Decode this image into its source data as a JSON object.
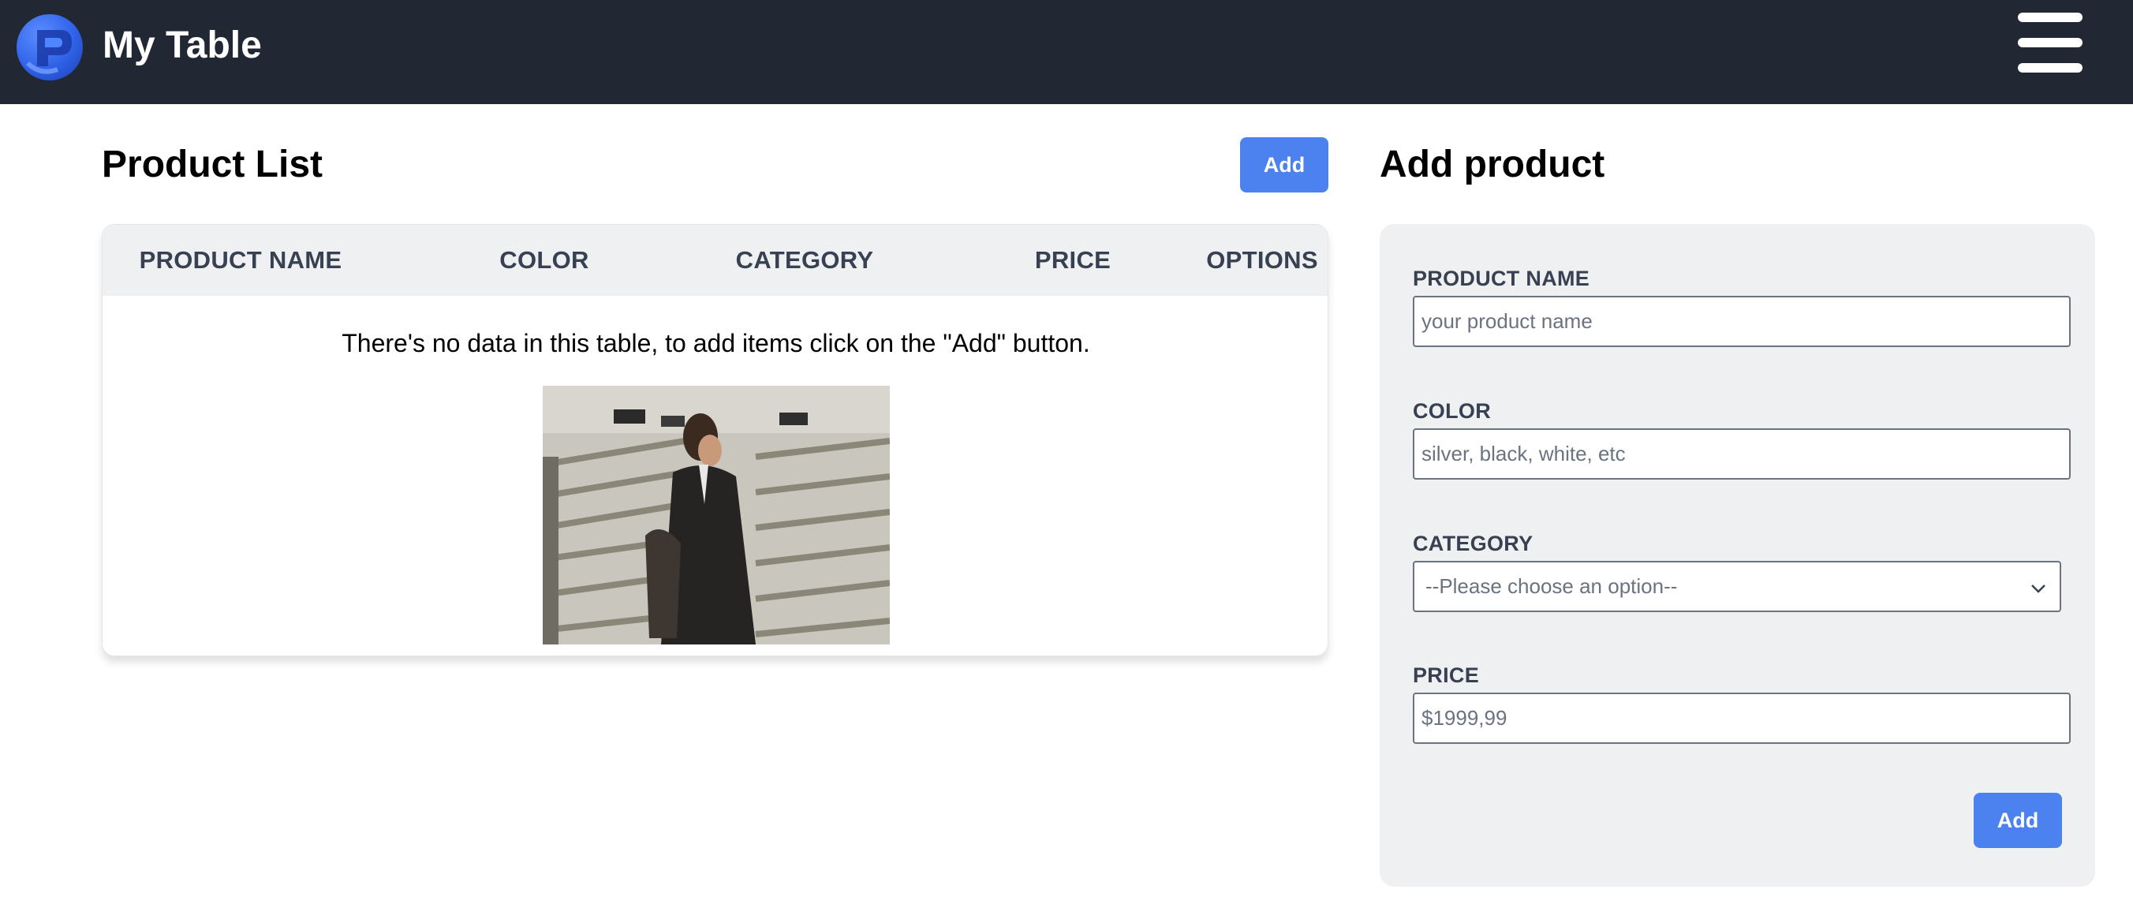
{
  "navbar": {
    "brand": "My Table",
    "logo_icon": "logo-icon",
    "menu_icon": "hamburger-menu-icon",
    "background_color": "#222833"
  },
  "product_list": {
    "title": "Product List",
    "add_button": "Add",
    "columns": [
      "PRODUCT NAME",
      "COLOR",
      "CATEGORY",
      "PRICE",
      "OPTIONS"
    ],
    "empty_message": "There's no data in this table, to add items click on the \"Add\" button."
  },
  "add_product": {
    "title": "Add product",
    "fields": {
      "product_name": {
        "label": "PRODUCT NAME",
        "placeholder": "your product name"
      },
      "color": {
        "label": "COLOR",
        "placeholder": "silver, black, white, etc"
      },
      "category": {
        "label": "CATEGORY",
        "selected": "--Please choose an option--"
      },
      "price": {
        "label": "PRICE",
        "placeholder": "$1999,99"
      }
    },
    "submit_button": "Add"
  },
  "colors": {
    "accent": "#4b82ef",
    "panel": "#eff0f2",
    "header_text": "#374151"
  }
}
